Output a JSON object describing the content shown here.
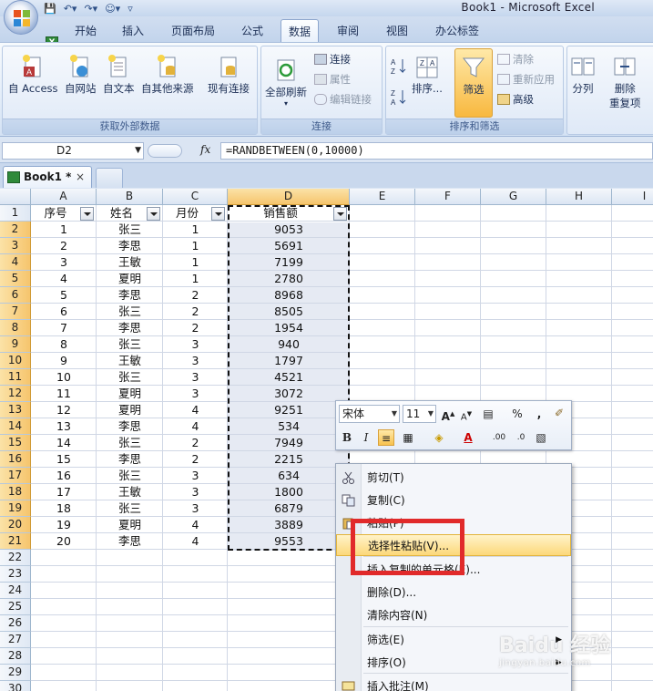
{
  "window": {
    "title": "Book1 - Microsoft Excel"
  },
  "ribbon_tabs": [
    "开始",
    "插入",
    "页面布局",
    "公式",
    "数据",
    "审阅",
    "视图",
    "办公标签"
  ],
  "ribbon": {
    "get_external": {
      "label": "获取外部数据",
      "buttons": [
        "自 Access",
        "自网站",
        "自文本",
        "自其他来源",
        "现有连接"
      ]
    },
    "connections": {
      "label": "连接",
      "refresh_all": "全部刷新",
      "connections": "连接",
      "properties": "属性",
      "edit_links": "编辑链接"
    },
    "sort_filter": {
      "label": "排序和筛选",
      "sort": "排序...",
      "filter": "筛选",
      "clear": "清除",
      "reapply": "重新应用",
      "advanced": "高级"
    },
    "data_tools": {
      "split": "分列",
      "remove_dup_1": "删除",
      "remove_dup_2": "重复项"
    }
  },
  "formula_bar": {
    "name_box": "D2",
    "fx": "fx",
    "formula": "=RANDBETWEEN(0,10000)"
  },
  "workbook_tab": {
    "name": "Book1 *",
    "close": "×"
  },
  "columns": [
    "A",
    "B",
    "C",
    "D",
    "E",
    "F",
    "G",
    "H",
    "I"
  ],
  "headers": {
    "a": "序号",
    "b": "姓名",
    "c": "月份",
    "d": "销售额"
  },
  "rows": [
    {
      "a": "1",
      "b": "张三",
      "c": "1",
      "d": "9053"
    },
    {
      "a": "2",
      "b": "李思",
      "c": "1",
      "d": "5691"
    },
    {
      "a": "3",
      "b": "王敏",
      "c": "1",
      "d": "7199"
    },
    {
      "a": "4",
      "b": "夏明",
      "c": "1",
      "d": "2780"
    },
    {
      "a": "5",
      "b": "李思",
      "c": "2",
      "d": "8968"
    },
    {
      "a": "6",
      "b": "张三",
      "c": "2",
      "d": "8505"
    },
    {
      "a": "7",
      "b": "李思",
      "c": "2",
      "d": "1954"
    },
    {
      "a": "8",
      "b": "张三",
      "c": "3",
      "d": "940"
    },
    {
      "a": "9",
      "b": "王敏",
      "c": "3",
      "d": "1797"
    },
    {
      "a": "10",
      "b": "张三",
      "c": "3",
      "d": "4521"
    },
    {
      "a": "11",
      "b": "夏明",
      "c": "3",
      "d": "3072"
    },
    {
      "a": "12",
      "b": "夏明",
      "c": "4",
      "d": "9251"
    },
    {
      "a": "13",
      "b": "李思",
      "c": "4",
      "d": "534"
    },
    {
      "a": "14",
      "b": "张三",
      "c": "2",
      "d": "7949"
    },
    {
      "a": "15",
      "b": "李思",
      "c": "2",
      "d": "2215"
    },
    {
      "a": "16",
      "b": "张三",
      "c": "3",
      "d": "634"
    },
    {
      "a": "17",
      "b": "王敏",
      "c": "3",
      "d": "1800"
    },
    {
      "a": "18",
      "b": "张三",
      "c": "3",
      "d": "6879"
    },
    {
      "a": "19",
      "b": "夏明",
      "c": "4",
      "d": "3889"
    },
    {
      "a": "20",
      "b": "李思",
      "c": "4",
      "d": "9553"
    }
  ],
  "row_numbers": [
    "1",
    "2",
    "3",
    "4",
    "5",
    "6",
    "7",
    "8",
    "9",
    "10",
    "11",
    "12",
    "13",
    "14",
    "15",
    "16",
    "17",
    "18",
    "19",
    "20",
    "21",
    "22",
    "23",
    "24",
    "25",
    "26",
    "27",
    "28",
    "29",
    "30"
  ],
  "mini_toolbar": {
    "font": "宋体",
    "size": "11"
  },
  "context_menu": [
    {
      "label": "剪切(T)",
      "icon": "scissors-icon"
    },
    {
      "label": "复制(C)",
      "icon": "copy-icon"
    },
    {
      "label": "粘贴(P)",
      "icon": "paste-icon"
    },
    {
      "label": "选择性粘贴(V)...",
      "icon": "",
      "highlight": true
    },
    {
      "label": "插入复制的单元格(E)...",
      "icon": ""
    },
    {
      "label": "删除(D)...",
      "icon": ""
    },
    {
      "label": "清除内容(N)",
      "icon": ""
    },
    {
      "label": "筛选(E)",
      "icon": "",
      "submenu": true
    },
    {
      "label": "排序(O)",
      "icon": "",
      "submenu": true
    },
    {
      "label": "插入批注(M)",
      "icon": "comment-icon"
    }
  ],
  "watermark": {
    "brand": "Baidu 经验",
    "url": "jingyan.baidu.com"
  },
  "colors": {
    "selected_header": "#f6c56d",
    "highlight_box": "#e12a2a",
    "selection_fill": "#e6eaf3"
  }
}
